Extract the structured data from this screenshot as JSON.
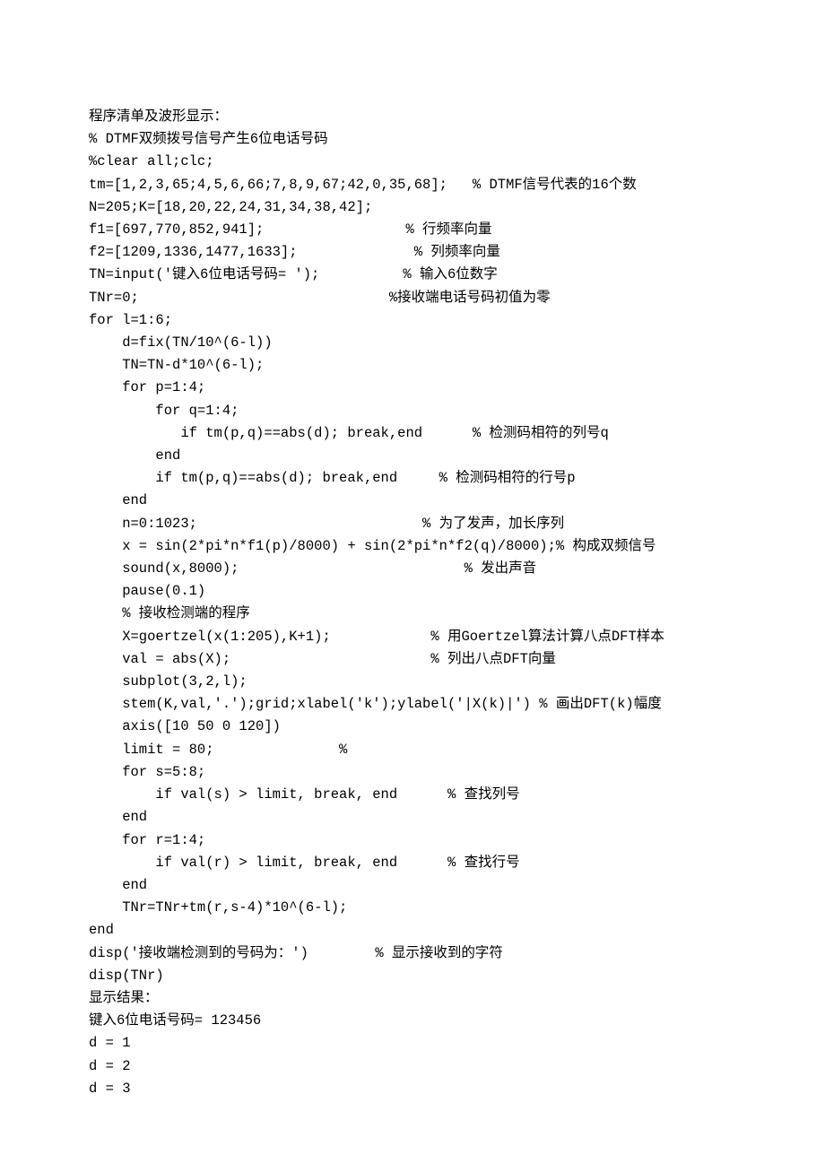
{
  "lines": [
    "程序清单及波形显示：",
    "% DTMF双频拨号信号产生6位电话号码",
    "%clear all;clc;",
    "tm=[1,2,3,65;4,5,6,66;7,8,9,67;42,0,35,68];   % DTMF信号代表的16个数",
    "N=205;K=[18,20,22,24,31,34,38,42];",
    "f1=[697,770,852,941];                 % 行频率向量",
    "f2=[1209,1336,1477,1633];              % 列频率向量",
    "TN=input('键入6位电话号码= ');          % 输入6位数字",
    "TNr=0;                              %接收端电话号码初值为零",
    "for l=1:6;",
    "    d=fix(TN/10^(6-l))",
    "    TN=TN-d*10^(6-l);",
    "    for p=1:4;",
    "        for q=1:4;",
    "           if tm(p,q)==abs(d); break,end      % 检测码相符的列号q",
    "        end",
    "        if tm(p,q)==abs(d); break,end     % 检测码相符的行号p",
    "    end",
    "    n=0:1023;                           % 为了发声，加长序列",
    "    x = sin(2*pi*n*f1(p)/8000) + sin(2*pi*n*f2(q)/8000);% 构成双频信号",
    "    sound(x,8000);                           % 发出声音",
    "    pause(0.1)",
    "    % 接收检测端的程序",
    "    X=goertzel(x(1:205),K+1);            % 用Goertzel算法计算八点DFT样本",
    "    val = abs(X);                        % 列出八点DFT向量",
    "    subplot(3,2,l);",
    "    stem(K,val,'.');grid;xlabel('k');ylabel('|X(k)|') % 画出DFT(k)幅度",
    "    axis([10 50 0 120])",
    "    limit = 80;               %",
    "    for s=5:8;",
    "        if val(s) > limit, break, end      % 查找列号",
    "    end",
    "    for r=1:4;",
    "        if val(r) > limit, break, end      % 查找行号",
    "    end",
    "    TNr=TNr+tm(r,s-4)*10^(6-l);",
    "end",
    "disp('接收端检测到的号码为：')        % 显示接收到的字符",
    "disp(TNr)",
    "显示结果：",
    "键入6位电话号码= 123456",
    "d = 1",
    "d = 2",
    "d = 3"
  ]
}
